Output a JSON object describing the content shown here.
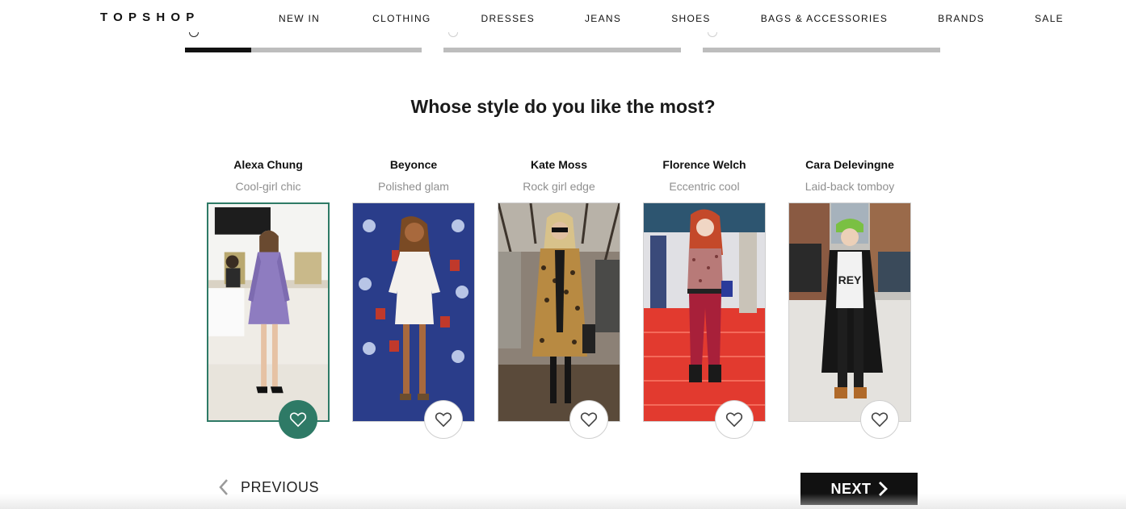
{
  "header": {
    "logo": "TOPSHOP",
    "nav": [
      "NEW IN",
      "CLOTHING",
      "DRESSES",
      "JEANS",
      "SHOES",
      "BAGS & ACCESSORIES",
      "BRANDS",
      "SALE"
    ]
  },
  "progress": {
    "steps": 3,
    "current_step_fraction": 0.28
  },
  "quiz": {
    "question": "Whose style do you like the most?",
    "options": [
      {
        "name": "Alexa Chung",
        "tagline": "Cool-girl chic",
        "selected": true
      },
      {
        "name": "Beyonce",
        "tagline": "Polished glam",
        "selected": false
      },
      {
        "name": "Kate Moss",
        "tagline": "Rock girl edge",
        "selected": false
      },
      {
        "name": "Florence Welch",
        "tagline": "Eccentric cool",
        "selected": false
      },
      {
        "name": "Cara Delevingne",
        "tagline": "Laid-back tomboy",
        "selected": false
      }
    ]
  },
  "footer": {
    "previous_label": "PREVIOUS",
    "next_label": "NEXT"
  },
  "colors": {
    "accent": "#2e7a66",
    "dark": "#111111",
    "muted": "#8f8f8f",
    "track": "#bdbdbd"
  },
  "icons": [
    "heart-icon",
    "chevron-left-icon",
    "chevron-right-icon"
  ]
}
